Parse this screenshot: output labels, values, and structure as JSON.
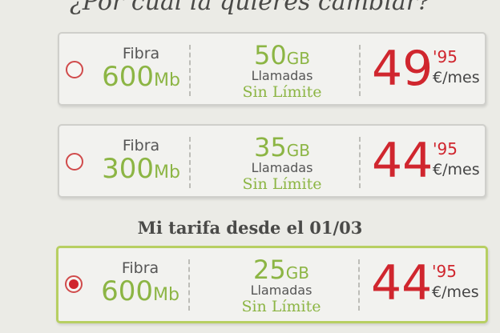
{
  "heading": "¿Por cuál la quieres cambiar?",
  "section_title": "Mi tarifa desde el 01/03",
  "plans": [
    {
      "fibra_label": "Fibra",
      "speed": "600",
      "speed_unit": "Mb",
      "data": "50",
      "data_unit": "GB",
      "calls_label": "Llamadas",
      "unlimited_label": "Sin Límite",
      "price_int": "49",
      "price_dec": "'95",
      "price_unit": "€/mes",
      "selected": false
    },
    {
      "fibra_label": "Fibra",
      "speed": "300",
      "speed_unit": "Mb",
      "data": "35",
      "data_unit": "GB",
      "calls_label": "Llamadas",
      "unlimited_label": "Sin Límite",
      "price_int": "44",
      "price_dec": "'95",
      "price_unit": "€/mes",
      "selected": false
    },
    {
      "fibra_label": "Fibra",
      "speed": "600",
      "speed_unit": "Mb",
      "data": "25",
      "data_unit": "GB",
      "calls_label": "Llamadas",
      "unlimited_label": "Sin Límite",
      "price_int": "44",
      "price_dec": "'95",
      "price_unit": "€/mes",
      "selected": true
    }
  ],
  "colors": {
    "accent_green": "#8cb544",
    "price_red": "#d0262e",
    "selected_border": "#b7cf62"
  }
}
